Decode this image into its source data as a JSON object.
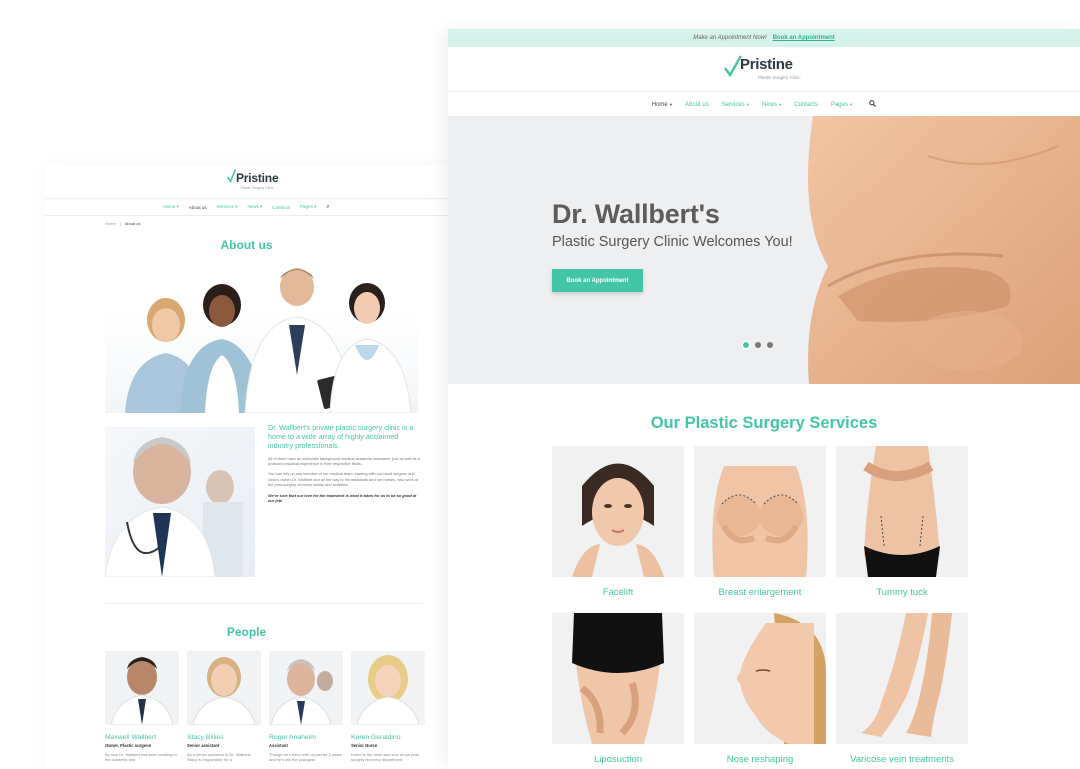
{
  "back_page": {
    "logo": {
      "name": "Pristine",
      "tagline": "Plastic Surgery Clinic"
    },
    "nav": [
      {
        "label": "Home",
        "caret": true,
        "active": false
      },
      {
        "label": "About us",
        "caret": false,
        "active": true
      },
      {
        "label": "Services",
        "caret": true,
        "active": false
      },
      {
        "label": "News",
        "caret": true,
        "active": false
      },
      {
        "label": "Contacts",
        "caret": false,
        "active": false
      },
      {
        "label": "Pages",
        "caret": true,
        "active": false
      }
    ],
    "breadcrumb": {
      "home": "Home",
      "current": "About us"
    },
    "about_title": "About us",
    "intro_lead": "Dr. Wallbert's private plastic surgery clinic is a home to a wide array of highly acclaimed industry professionals.",
    "intro_p1": "All of them have an elaborate background medical academic education, just as well as a profound practical experience in their respective fields...",
    "intro_p2": "You can rely on any member of our medical team, starting with our head surgeon and clinic's owner Dr. Wallbert and all the way to his assistants and our nurses, who work at the post-surgery recovery facility and activities.",
    "intro_p3": "We're sure that our love for the teamwork is what it takes for us to be so good at our job!",
    "people_title": "People",
    "people": [
      {
        "name": "Maxwell Wallbert",
        "role": "Owner, Plastic surgeon",
        "desc": "By now Dr. Wallbert has been working in the cosmetic and"
      },
      {
        "name": "Stacy Billies",
        "role": "Senior assistant",
        "desc": "As a senior assistant to Dr. Wallbert, Stacy is responsible for a"
      },
      {
        "name": "Roger Anaheim",
        "role": "Assistant",
        "desc": "Though he's been with us just for 2 years and he's still the youngest"
      },
      {
        "name": "Karen Geraldino",
        "role": "Senior Nurse",
        "desc": "Karen is the heart and soul of our post-surgery recovery department."
      }
    ]
  },
  "front_page": {
    "topbar": {
      "message": "Make an Appointment Now!",
      "link": "Book an Appointment"
    },
    "logo": {
      "name": "Pristine",
      "tagline": "Plastic Surgery Clinic"
    },
    "nav": [
      {
        "label": "Home",
        "caret": true,
        "active": true
      },
      {
        "label": "About us",
        "caret": false,
        "active": false
      },
      {
        "label": "Services",
        "caret": true,
        "active": false
      },
      {
        "label": "News",
        "caret": true,
        "active": false
      },
      {
        "label": "Contacts",
        "caret": false,
        "active": false
      },
      {
        "label": "Pages",
        "caret": true,
        "active": false
      }
    ],
    "search_icon": "search-icon",
    "hero": {
      "title": "Dr. Wallbert's",
      "subtitle": "Plastic Surgery Clinic Welcomes You!",
      "button": "Book an Appointment",
      "slides": 3,
      "active_slide": 1
    },
    "services_title": "Our Plastic Surgery Services",
    "services": [
      {
        "label": "Facelift"
      },
      {
        "label": "Breast enlargement"
      },
      {
        "label": "Tummy tuck"
      },
      {
        "label": "Liposuction"
      },
      {
        "label": "Nose reshaping"
      },
      {
        "label": "Varicose vein treatments"
      }
    ]
  },
  "colors": {
    "accent": "#43c6a7",
    "topbar_bg": "#d6f3eb",
    "text_dark": "#5d5d5d",
    "hero_bg": "#eeeff0"
  }
}
